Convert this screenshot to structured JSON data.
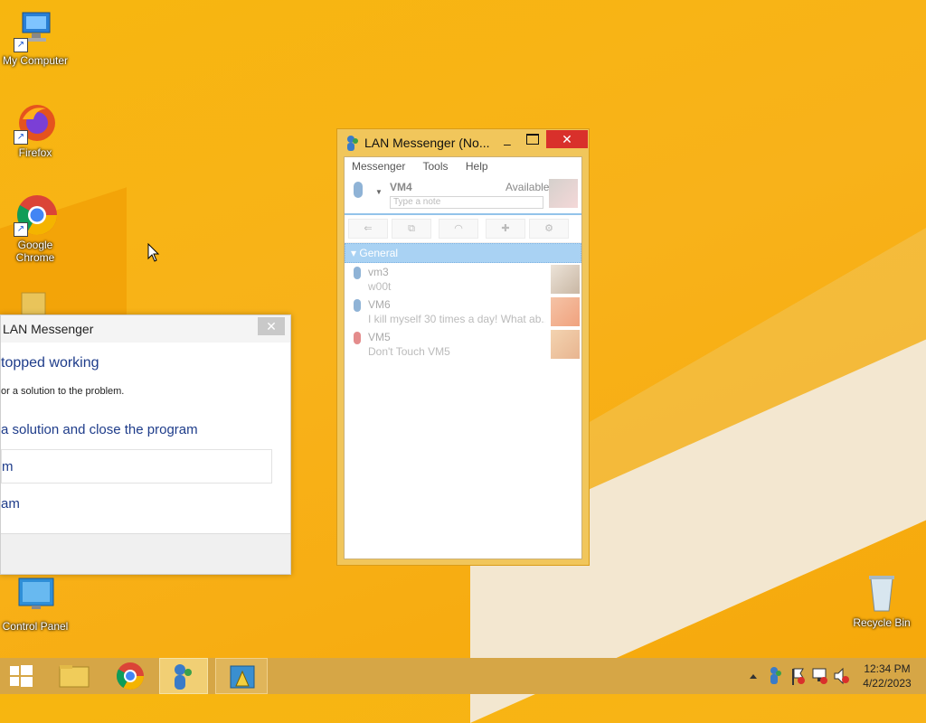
{
  "desktop": {
    "icons": [
      {
        "label": "My Computer"
      },
      {
        "label": "Firefox"
      },
      {
        "label": "Google Chrome"
      },
      {
        "label": "Control Panel"
      },
      {
        "label": "Recycle Bin"
      }
    ]
  },
  "error_dialog": {
    "title": "LAN Messenger",
    "close": "✕",
    "heading": "topped working",
    "description": "or a solution to the problem.",
    "option1": "a solution and close the program",
    "option2": "m",
    "option3": "am"
  },
  "messenger": {
    "title": "LAN Messenger (No...",
    "menu": [
      "Messenger",
      "Tools",
      "Help"
    ],
    "user": {
      "name": "VM4",
      "status": "Available",
      "note_placeholder": "Type a note"
    },
    "group": "General",
    "contacts": [
      {
        "name": "vm3",
        "status": "w00t",
        "color": "#8fb3d6"
      },
      {
        "name": "VM6",
        "status": "I kill myself 30 times a day! What ab...",
        "color": "#8fb3d6"
      },
      {
        "name": "VM5",
        "status": "Don't Touch VM5",
        "color": "#e48c8c"
      }
    ]
  },
  "taskbar": {
    "clock_time": "12:34 PM",
    "clock_date": "4/22/2023"
  },
  "colors": {
    "accent": "#d9302b",
    "taskbar": "#d6a646",
    "group_header": "#a9d2f3"
  }
}
